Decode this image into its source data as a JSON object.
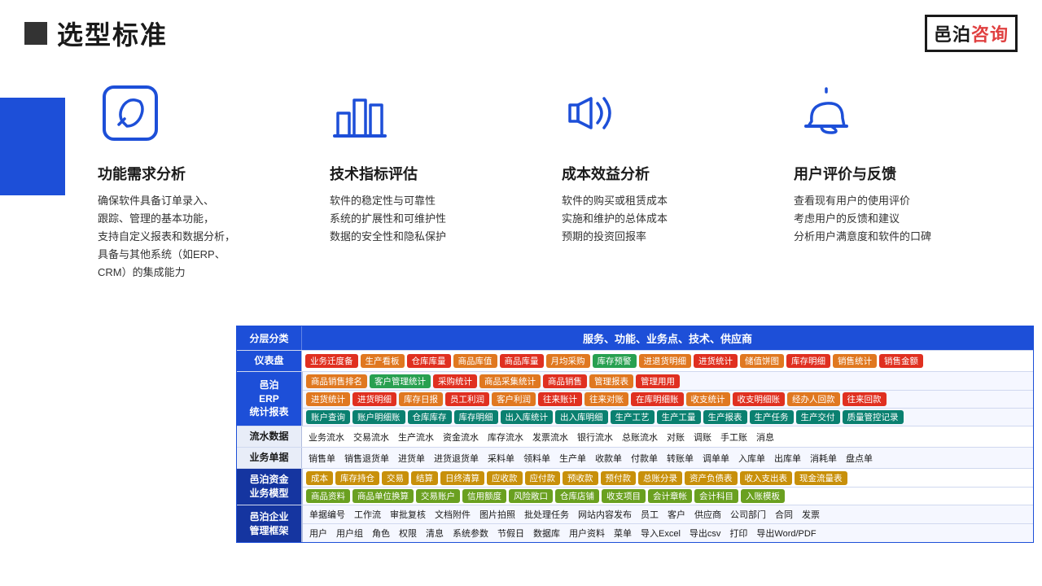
{
  "header": {
    "title": "选型标准",
    "logo_text1": "邑泊",
    "logo_text2": "咨询"
  },
  "columns": [
    {
      "id": "func",
      "title": "功能需求分析",
      "text": "确保软件具备订单录入、\n跟踪、管理的基本功能，\n支持自定义报表和数据分析，\n具备与其他系统（如ERP、\nCRM）的集成能力"
    },
    {
      "id": "tech",
      "title": "技术指标评估",
      "text": "软件的稳定性与可靠性\n系统的扩展性和可维护性\n数据的安全性和隐私保护"
    },
    {
      "id": "cost",
      "title": "成本效益分析",
      "text": "软件的购买或租赁成本\n实施和维护的总体成本\n预期的投资回报率"
    },
    {
      "id": "user",
      "title": "用户评价与反馈",
      "text": "查看现有用户的使用评价\n考虑用户的反馈和建议\n分析用户满意度和软件的口碑"
    }
  ],
  "table": {
    "header_left": "分层分类",
    "header_right": "服务、功能、业务点、技术、供应商",
    "rows": [
      {
        "label": "仪表盘",
        "label_style": "blue-bg",
        "tags": [
          {
            "text": "业务迁度备",
            "color": "red"
          },
          {
            "text": "生产看板",
            "color": "orange"
          },
          {
            "text": "仓库库量",
            "color": "red"
          },
          {
            "text": "商品库值",
            "color": "orange"
          },
          {
            "text": "商品库量",
            "color": "red"
          },
          {
            "text": "月均采购",
            "color": "orange"
          },
          {
            "text": "库存预警",
            "color": "green"
          },
          {
            "text": "进退货明细",
            "color": "orange"
          },
          {
            "text": "进货统计",
            "color": "red"
          },
          {
            "text": "储值饼图",
            "color": "orange"
          },
          {
            "text": "库存明细",
            "color": "red"
          },
          {
            "text": "销售统计",
            "color": "orange"
          },
          {
            "text": "销售金额",
            "color": "red"
          }
        ]
      },
      {
        "label": "邑泊\nERP\n统计报表",
        "label_style": "blue-bg",
        "multi_sub": true,
        "sub_rows": [
          [
            {
              "text": "商品销售排名",
              "color": "orange"
            },
            {
              "text": "客户管理统计",
              "color": "green"
            },
            {
              "text": "采购统计",
              "color": "red"
            },
            {
              "text": "商品采集统计",
              "color": "orange"
            },
            {
              "text": "商品销售",
              "color": "red"
            },
            {
              "text": "管理报表",
              "color": "orange"
            },
            {
              "text": "管理用用",
              "color": "red"
            }
          ],
          [
            {
              "text": "进货统计",
              "color": "orange"
            },
            {
              "text": "进货明细",
              "color": "red"
            },
            {
              "text": "库存日报",
              "color": "orange"
            },
            {
              "text": "员工利润",
              "color": "red"
            },
            {
              "text": "客户利润",
              "color": "orange"
            },
            {
              "text": "往来账计",
              "color": "red"
            },
            {
              "text": "往来对账",
              "color": "orange"
            },
            {
              "text": "在库明细账",
              "color": "red"
            },
            {
              "text": "收支统计",
              "color": "orange"
            },
            {
              "text": "收支明细账",
              "color": "red"
            },
            {
              "text": "经办人回款",
              "color": "orange"
            },
            {
              "text": "往来回款",
              "color": "red"
            }
          ],
          [
            {
              "text": "账户查询",
              "color": "teal"
            },
            {
              "text": "账户明细账",
              "color": "teal"
            },
            {
              "text": "仓库库存",
              "color": "teal"
            },
            {
              "text": "库存明细",
              "color": "teal"
            },
            {
              "text": "出入库统计",
              "color": "teal"
            },
            {
              "text": "出入库明细",
              "color": "teal"
            },
            {
              "text": "生产工艺",
              "color": "teal"
            },
            {
              "text": "生产工量",
              "color": "teal"
            },
            {
              "text": "生产报表",
              "color": "teal"
            },
            {
              "text": "生产任务",
              "color": "teal"
            },
            {
              "text": "生产交付",
              "color": "teal"
            },
            {
              "text": "质量管控记录",
              "color": "teal"
            }
          ]
        ]
      },
      {
        "label": "流水数据",
        "label_style": "",
        "tags": [
          {
            "text": "业务流水",
            "color": "plain"
          },
          {
            "text": "交易流水",
            "color": "plain"
          },
          {
            "text": "生产流水",
            "color": "plain"
          },
          {
            "text": "资金流水",
            "color": "plain"
          },
          {
            "text": "库存流水",
            "color": "plain"
          },
          {
            "text": "发票流水",
            "color": "plain"
          },
          {
            "text": "银行流水",
            "color": "plain"
          },
          {
            "text": "总账流水",
            "color": "plain"
          },
          {
            "text": "对账",
            "color": "plain"
          },
          {
            "text": "调账",
            "color": "plain"
          },
          {
            "text": "手工账",
            "color": "plain"
          },
          {
            "text": "消息",
            "color": "plain"
          }
        ]
      },
      {
        "label": "业务单据",
        "label_style": "",
        "tags": [
          {
            "text": "销售单",
            "color": "plain"
          },
          {
            "text": "销售退货单",
            "color": "plain"
          },
          {
            "text": "进货单",
            "color": "plain"
          },
          {
            "text": "进货退货单",
            "color": "plain"
          },
          {
            "text": "采料单",
            "color": "plain"
          },
          {
            "text": "领料单",
            "color": "plain"
          },
          {
            "text": "生产单",
            "color": "plain"
          },
          {
            "text": "收款单",
            "color": "plain"
          },
          {
            "text": "付款单",
            "color": "plain"
          },
          {
            "text": "转账单",
            "color": "plain"
          },
          {
            "text": "调单单",
            "color": "plain"
          },
          {
            "text": "入库单",
            "color": "plain"
          },
          {
            "text": "出库单",
            "color": "plain"
          },
          {
            "text": "消耗单",
            "color": "plain"
          },
          {
            "text": "盘点单",
            "color": "plain"
          }
        ]
      },
      {
        "label": "邑泊资金\n业务模型",
        "label_style": "dark-blue",
        "multi_sub": true,
        "sub_rows": [
          [
            {
              "text": "成本",
              "color": "gold"
            },
            {
              "text": "库存持仓",
              "color": "gold"
            },
            {
              "text": "交易",
              "color": "gold"
            },
            {
              "text": "结算",
              "color": "gold"
            },
            {
              "text": "日终清算",
              "color": "gold"
            },
            {
              "text": "应收款",
              "color": "gold"
            },
            {
              "text": "应付款",
              "color": "gold"
            },
            {
              "text": "预收款",
              "color": "gold"
            },
            {
              "text": "预付款",
              "color": "gold"
            },
            {
              "text": "总账分录",
              "color": "gold"
            },
            {
              "text": "资产负债表",
              "color": "gold"
            },
            {
              "text": "收入支出表",
              "color": "gold"
            },
            {
              "text": "现金流量表",
              "color": "gold"
            }
          ],
          [
            {
              "text": "商品资料",
              "color": "lime"
            },
            {
              "text": "商品单位换算",
              "color": "lime"
            },
            {
              "text": "交易账户",
              "color": "lime"
            },
            {
              "text": "信用额度",
              "color": "lime"
            },
            {
              "text": "风险敞口",
              "color": "lime"
            },
            {
              "text": "仓库店铺",
              "color": "lime"
            },
            {
              "text": "收支项目",
              "color": "lime"
            },
            {
              "text": "会计章帐",
              "color": "lime"
            },
            {
              "text": "会计科目",
              "color": "lime"
            },
            {
              "text": "入账模板",
              "color": "lime"
            }
          ]
        ]
      },
      {
        "label": "邑泊企业\n管理框架",
        "label_style": "dark-blue",
        "multi_sub": true,
        "sub_rows": [
          [
            {
              "text": "单据编号",
              "color": "plain"
            },
            {
              "text": "工作流",
              "color": "plain"
            },
            {
              "text": "审批复核",
              "color": "plain"
            },
            {
              "text": "文档附件",
              "color": "plain"
            },
            {
              "text": "图片拍照",
              "color": "plain"
            },
            {
              "text": "批处理任务",
              "color": "plain"
            },
            {
              "text": "网站内容发布",
              "color": "plain"
            },
            {
              "text": "员工",
              "color": "plain"
            },
            {
              "text": "客户",
              "color": "plain"
            },
            {
              "text": "供应商",
              "color": "plain"
            },
            {
              "text": "公司部门",
              "color": "plain"
            },
            {
              "text": "合同",
              "color": "plain"
            },
            {
              "text": "发票",
              "color": "plain"
            }
          ],
          [
            {
              "text": "用户",
              "color": "plain"
            },
            {
              "text": "用户组",
              "color": "plain"
            },
            {
              "text": "角色",
              "color": "plain"
            },
            {
              "text": "权限",
              "color": "plain"
            },
            {
              "text": "清息",
              "color": "plain"
            },
            {
              "text": "系统参数",
              "color": "plain"
            },
            {
              "text": "节假日",
              "color": "plain"
            },
            {
              "text": "数据库",
              "color": "plain"
            },
            {
              "text": "用户资料",
              "color": "plain"
            },
            {
              "text": "菜单",
              "color": "plain"
            },
            {
              "text": "导入Excel",
              "color": "plain"
            },
            {
              "text": "导出csv",
              "color": "plain"
            },
            {
              "text": "打印",
              "color": "plain"
            },
            {
              "text": "导出Word/PDF",
              "color": "plain"
            }
          ]
        ]
      }
    ]
  }
}
